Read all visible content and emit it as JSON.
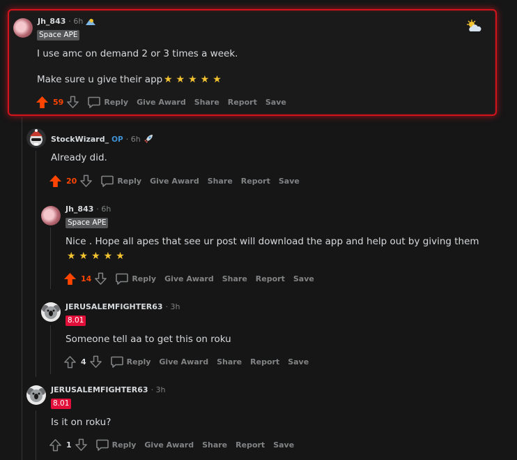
{
  "comments": [
    {
      "username": "Jh_843",
      "time": "· 6h",
      "emoji": "sun-mountain-icon",
      "flair": "Space APE",
      "body_lines": [
        "I use amc on demand 2 or 3 times a week.",
        "Make sure u give their app"
      ],
      "stars": "★★★★★",
      "score": "59",
      "upvoted": true
    },
    {
      "username": "StockWizard_",
      "op_label": "OP",
      "time": "· 6h",
      "emoji": "rocket-icon",
      "body_lines": [
        "Already did."
      ],
      "score": "20",
      "upvoted": true
    },
    {
      "username": "Jh_843",
      "time": "· 6h",
      "flair": "Space APE",
      "body_lines": [
        "Nice . Hope all apes that see ur post will download the app and help out by giving them"
      ],
      "stars": "★★★★★",
      "score": "14",
      "upvoted": true
    },
    {
      "username": "JERUSALEMFIGHTER63",
      "time": "· 3h",
      "flair": "8.01",
      "body_lines": [
        "Someone tell aa to get this on roku"
      ],
      "score": "4",
      "upvoted": false
    },
    {
      "username": "JERUSALEMFIGHTER63",
      "time": "· 3h",
      "flair": "8.01",
      "body_lines": [
        "Is it on roku?"
      ],
      "score": "1",
      "upvoted": false
    }
  ],
  "actions": {
    "reply": "Reply",
    "give_award": "Give Award",
    "share": "Share",
    "report": "Report",
    "save": "Save"
  },
  "corner_emoji": "sun-behind-cloud-icon",
  "colors": {
    "background": "#161617",
    "highlight_border": "#d4141c",
    "upvote": "#ff4500",
    "op": "#3e93d4",
    "flair_gray": "#545658",
    "flair_red": "#e0103a",
    "star": "#f4c430"
  }
}
